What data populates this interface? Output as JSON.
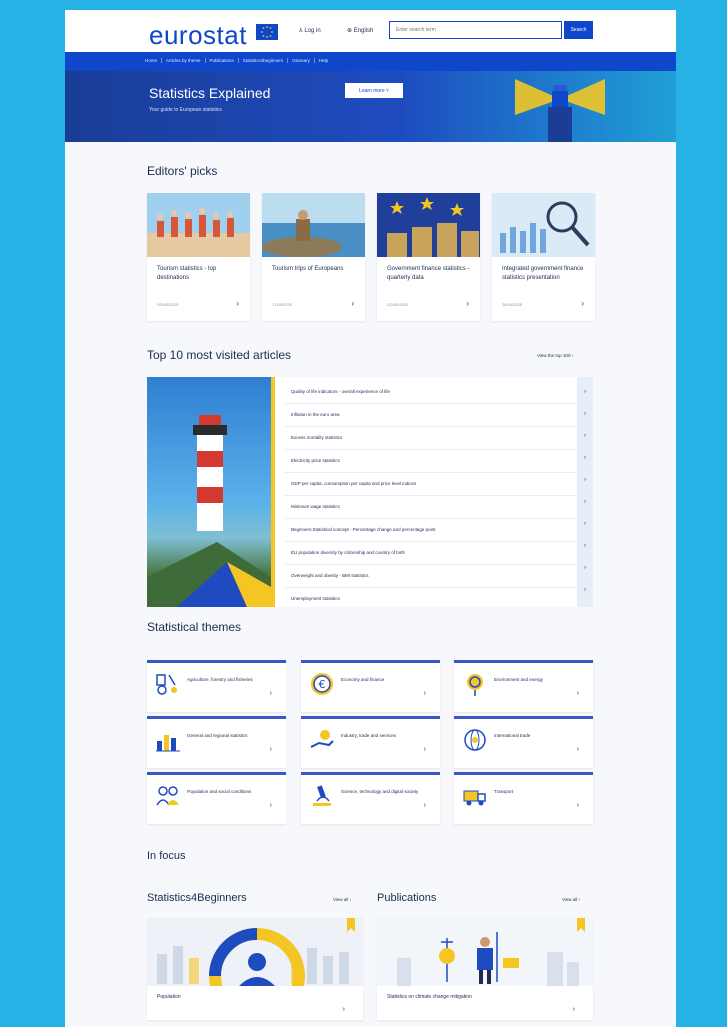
{
  "header": {
    "logo": "eurostat",
    "login": "⅄ Log in",
    "language": "⊕ English",
    "search_placeholder": "Enter search term",
    "search_button": "Search"
  },
  "nav": {
    "items": [
      "Home",
      "Articles by theme",
      "Publications",
      "Statistics4beginners",
      "Glossary",
      "Help"
    ]
  },
  "hero": {
    "title": "Statistics Explained",
    "subtitle": "Your guide to European statistics",
    "button": "Learn more ˅"
  },
  "editors_picks": {
    "heading": "Editors' picks",
    "cards": [
      {
        "title": "Tourism statistics - top destinations",
        "date": "DD/05/2025"
      },
      {
        "title": "Tourism trips of Europeans",
        "date": "17/05/2025"
      },
      {
        "title": "Government finance statistics - quarterly data",
        "date": "DD/05/2025"
      },
      {
        "title": "Integrated government finance statistics presentation",
        "date": "28/04/2025"
      }
    ]
  },
  "top10": {
    "heading": "Top 10 most visited articles",
    "view_all": "View the top 100 ›",
    "articles": [
      "Quality of life indicators - overall experience of life",
      "Inflation in the euro area",
      "Excess mortality statistics",
      "Electricity price statistics",
      "GDP per capita, consumption per capita and price level indices",
      "Minimum wage statistics",
      "Beginners:Statistical concept - Percentage change and percentage point",
      "EU population diversity by citizenship and country of birth",
      "Overweight and obesity - BMI statistics",
      "Unemployment statistics"
    ]
  },
  "themes": {
    "heading": "Statistical themes",
    "items": [
      {
        "label": "Agriculture, forestry and fisheries",
        "icon": "tractor-icon"
      },
      {
        "label": "Economy and finance",
        "icon": "euro-icon"
      },
      {
        "label": "Environment and energy",
        "icon": "leaf-pin-icon"
      },
      {
        "label": "General and regional statistics",
        "icon": "bar-chart-icon"
      },
      {
        "label": "Industry, trade and services",
        "icon": "hand-coins-icon"
      },
      {
        "label": "International trade",
        "icon": "globe-trade-icon"
      },
      {
        "label": "Population and social conditions",
        "icon": "people-icon"
      },
      {
        "label": "Science, technology and digital society",
        "icon": "microscope-icon"
      },
      {
        "label": "Transport",
        "icon": "truck-icon"
      }
    ]
  },
  "in_focus": {
    "heading": "In focus",
    "beginners": {
      "heading": "Statistics4Beginners",
      "view_all": "View all ›",
      "card_title": "Population"
    },
    "publications": {
      "heading": "Publications",
      "view_all": "View all ›",
      "card_title": "Statistics on climate change mitigation"
    }
  },
  "colors": {
    "brand_blue": "#0e47cb",
    "frame_blue": "#27b2e6",
    "accent_yellow": "#f3c623"
  }
}
